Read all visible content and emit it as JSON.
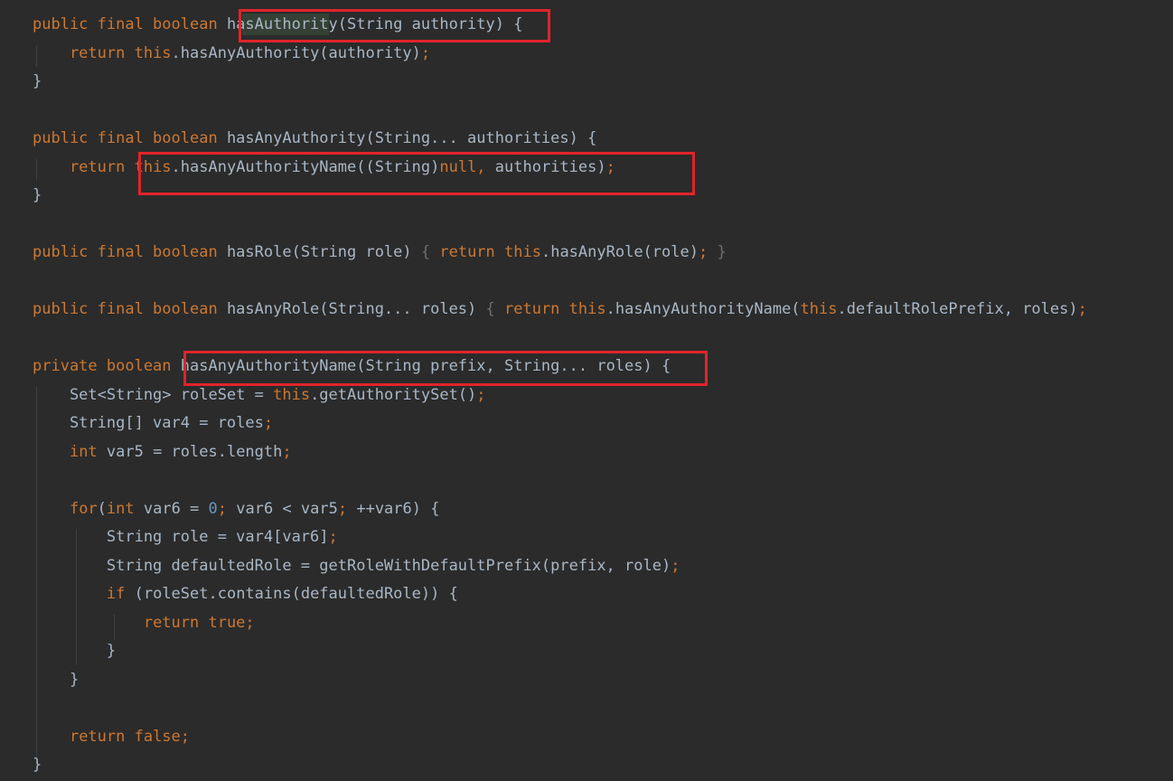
{
  "accent_color": "#e0242b",
  "code_lines": [
    [
      {
        "t": "public final boolean ",
        "c": "kw"
      },
      {
        "t": "hasAuthority(String authority) ",
        "c": "plain"
      },
      {
        "t": "{",
        "c": "plain"
      }
    ],
    [
      {
        "t": "    return ",
        "c": "kw"
      },
      {
        "t": "this",
        "c": "kw"
      },
      {
        "t": ".hasAnyAuthority(authority)",
        "c": "plain"
      },
      {
        "t": ";",
        "c": "kw"
      }
    ],
    [
      {
        "t": "}",
        "c": "plain"
      }
    ],
    [],
    [
      {
        "t": "public final boolean ",
        "c": "kw"
      },
      {
        "t": "hasAnyAuthority(String... authorities) {",
        "c": "plain"
      }
    ],
    [
      {
        "t": "    return ",
        "c": "kw"
      },
      {
        "t": "this",
        "c": "kw"
      },
      {
        "t": ".hasAnyAuthorityName((String)",
        "c": "plain"
      },
      {
        "t": "null, ",
        "c": "kw"
      },
      {
        "t": "authorities)",
        "c": "plain"
      },
      {
        "t": ";",
        "c": "kw"
      }
    ],
    [
      {
        "t": "}",
        "c": "plain"
      }
    ],
    [],
    [
      {
        "t": "public final boolean ",
        "c": "kw"
      },
      {
        "t": "hasRole(String role) ",
        "c": "plain"
      },
      {
        "t": "{ ",
        "c": "fold"
      },
      {
        "t": "return ",
        "c": "kw"
      },
      {
        "t": "this",
        "c": "kw"
      },
      {
        "t": ".hasAnyRole(role)",
        "c": "plain"
      },
      {
        "t": "; ",
        "c": "kw"
      },
      {
        "t": "}",
        "c": "fold"
      }
    ],
    [],
    [
      {
        "t": "public final boolean ",
        "c": "kw"
      },
      {
        "t": "hasAnyRole(String... roles) ",
        "c": "plain"
      },
      {
        "t": "{ ",
        "c": "fold"
      },
      {
        "t": "return ",
        "c": "kw"
      },
      {
        "t": "this",
        "c": "kw"
      },
      {
        "t": ".hasAnyAuthorityName(",
        "c": "plain"
      },
      {
        "t": "this",
        "c": "kw"
      },
      {
        "t": ".defaultRolePrefix, roles)",
        "c": "plain"
      },
      {
        "t": ";",
        "c": "kw"
      }
    ],
    [],
    [
      {
        "t": "private boolean ",
        "c": "kw"
      },
      {
        "t": "hasAnyAuthorityName(String prefix, String... roles) {",
        "c": "plain"
      }
    ],
    [
      {
        "t": "    Set<String> roleSet = ",
        "c": "plain"
      },
      {
        "t": "this",
        "c": "kw"
      },
      {
        "t": ".getAuthoritySet()",
        "c": "plain"
      },
      {
        "t": ";",
        "c": "kw"
      }
    ],
    [
      {
        "t": "    String[] var4 = roles",
        "c": "plain"
      },
      {
        "t": ";",
        "c": "kw"
      }
    ],
    [
      {
        "t": "    ",
        "c": "plain"
      },
      {
        "t": "int ",
        "c": "kw"
      },
      {
        "t": "var5 = roles.length",
        "c": "plain"
      },
      {
        "t": ";",
        "c": "kw"
      }
    ],
    [],
    [
      {
        "t": "    ",
        "c": "plain"
      },
      {
        "t": "for",
        "c": "kw"
      },
      {
        "t": "(",
        "c": "plain"
      },
      {
        "t": "int ",
        "c": "kw"
      },
      {
        "t": "var6 = ",
        "c": "plain"
      },
      {
        "t": "0",
        "c": "num"
      },
      {
        "t": "; ",
        "c": "kw"
      },
      {
        "t": "var6 < var5",
        "c": "plain"
      },
      {
        "t": "; ",
        "c": "kw"
      },
      {
        "t": "++var6) {",
        "c": "plain"
      }
    ],
    [
      {
        "t": "        String role = var4[var6]",
        "c": "plain"
      },
      {
        "t": ";",
        "c": "kw"
      }
    ],
    [
      {
        "t": "        String defaultedRole = getRoleWithDefaultPrefix(prefix, role)",
        "c": "plain"
      },
      {
        "t": ";",
        "c": "kw"
      }
    ],
    [
      {
        "t": "        ",
        "c": "plain"
      },
      {
        "t": "if ",
        "c": "kw"
      },
      {
        "t": "(roleSet.contains(defaultedRole)) {",
        "c": "plain"
      }
    ],
    [
      {
        "t": "            ",
        "c": "plain"
      },
      {
        "t": "return true",
        "c": "kw"
      },
      {
        "t": ";",
        "c": "kw"
      }
    ],
    [
      {
        "t": "        }",
        "c": "plain"
      }
    ],
    [
      {
        "t": "    }",
        "c": "plain"
      }
    ],
    [],
    [
      {
        "t": "    ",
        "c": "plain"
      },
      {
        "t": "return false",
        "c": "kw"
      },
      {
        "t": ";",
        "c": "kw"
      }
    ],
    [
      {
        "t": "}",
        "c": "plain"
      }
    ]
  ]
}
